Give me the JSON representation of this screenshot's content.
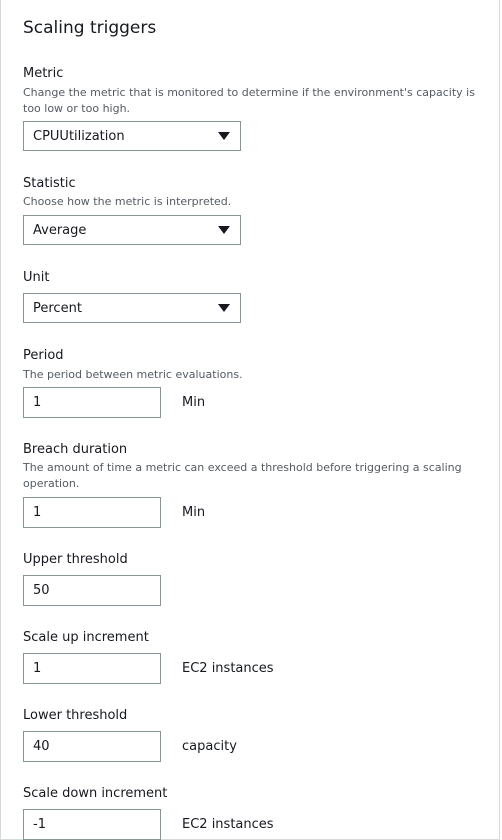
{
  "section": {
    "title": "Scaling triggers"
  },
  "metric": {
    "label": "Metric",
    "description": "Change the metric that is monitored to determine if the environment's capacity is too low or too high.",
    "value": "CPUUtilization"
  },
  "statistic": {
    "label": "Statistic",
    "description": "Choose how the metric is interpreted.",
    "value": "Average"
  },
  "unit": {
    "label": "Unit",
    "value": "Percent"
  },
  "period": {
    "label": "Period",
    "description": "The period between metric evaluations.",
    "value": "1",
    "suffix": "Min"
  },
  "breach_duration": {
    "label": "Breach duration",
    "description": "The amount of time a metric can exceed a threshold before triggering a scaling operation.",
    "value": "1",
    "suffix": "Min"
  },
  "upper_threshold": {
    "label": "Upper threshold",
    "value": "50"
  },
  "scale_up_increment": {
    "label": "Scale up increment",
    "value": "1",
    "suffix": "EC2 instances"
  },
  "lower_threshold": {
    "label": "Lower threshold",
    "value": "40",
    "suffix": "capacity"
  },
  "scale_down_increment": {
    "label": "Scale down increment",
    "value": "-1",
    "suffix": "EC2 instances"
  },
  "icons": {
    "dropdown": "caret-down-icon"
  }
}
